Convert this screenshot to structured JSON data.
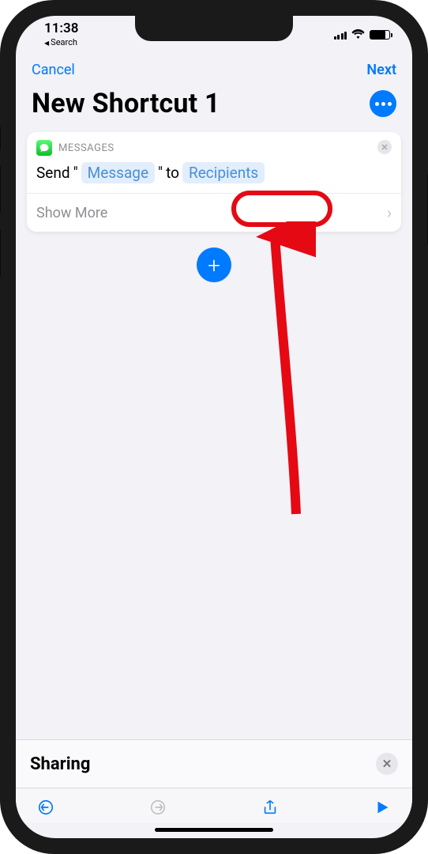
{
  "status": {
    "time": "11:38",
    "back_label": "Search"
  },
  "nav": {
    "cancel": "Cancel",
    "next": "Next"
  },
  "header": {
    "title": "New Shortcut 1"
  },
  "action": {
    "app_label": "MESSAGES",
    "prefix": "Send",
    "quote_open": "\"",
    "message_token": "Message",
    "quote_close": "\"",
    "to_word": "to",
    "recipients_token": "Recipients",
    "show_more": "Show More"
  },
  "sharing": {
    "title": "Sharing"
  }
}
